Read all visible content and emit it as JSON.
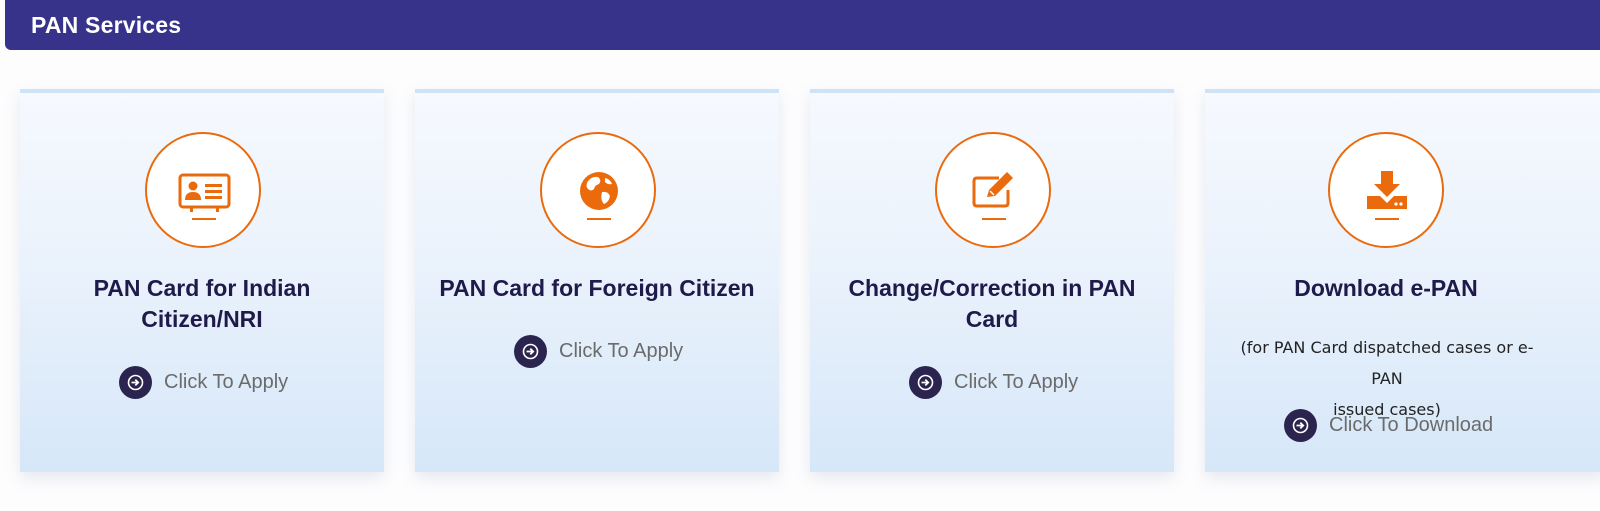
{
  "header": {
    "title": "PAN Services"
  },
  "cards": [
    {
      "title_line1": "PAN Card for Indian",
      "title_line2": "Citizen/NRI",
      "icon": "id-card-icon",
      "action_label": "Click To Apply"
    },
    {
      "title_line1": "PAN Card for Foreign Citizen",
      "icon": "globe-icon",
      "action_label": "Click To Apply"
    },
    {
      "title_line1": "Change/Correction in PAN",
      "title_line2": "Card",
      "icon": "edit-icon",
      "action_label": "Click To Apply"
    },
    {
      "title_line1": "Download e-PAN",
      "note_line1": "(for PAN Card dispatched cases or e-PAN",
      "note_line2": "issued cases)",
      "icon": "download-icon",
      "action_label": "Click To Download"
    }
  ],
  "colors": {
    "header_bg": "#37328a",
    "accent_orange": "#ea6a0c",
    "action_icon_bg": "#2a244e",
    "card_title": "#1f1a4a"
  }
}
